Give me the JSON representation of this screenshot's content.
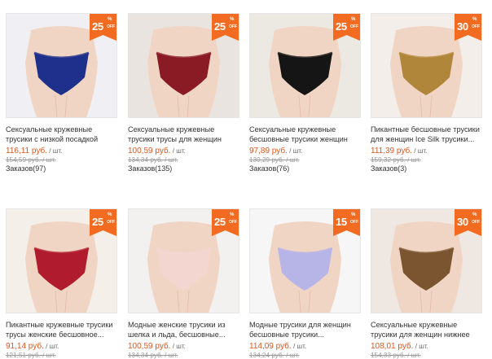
{
  "products": [
    {
      "title": "Сексуальные кружевные трусики с низкой посадкой трусики...",
      "price": "116,11 руб.",
      "unit": " / шт.",
      "old_price": "154,59 руб.",
      "orders": "Заказов(97)",
      "discount": "25",
      "product_color": "#1f2f8c",
      "bg": "#f0f0f4"
    },
    {
      "title": "Сексуальные кружевные трусики трусы для женщин бесшовное...",
      "price": "100,59 руб.",
      "unit": " / шт.",
      "old_price": "134,34 руб.",
      "orders": "Заказов(135)",
      "discount": "25",
      "product_color": "#8a1a24",
      "bg": "#e9e4e0"
    },
    {
      "title": "Сексуальные кружевные бесшовные трусики женщин нижнее белье...",
      "price": "97,89 руб.",
      "unit": " / шт.",
      "old_price": "130,29 руб.",
      "orders": "Заказов(76)",
      "discount": "25",
      "product_color": "#151515",
      "bg": "#ece9e3"
    },
    {
      "title": "Пикантные бесшовные трусики для женщин Ice Silk трусики...",
      "price": "111,39 руб.",
      "unit": " / шт.",
      "old_price": "159,32 руб.",
      "orders": "Заказов(3)",
      "discount": "30",
      "product_color": "#b0873a",
      "bg": "#f3eeea"
    },
    {
      "title": "Пикантные кружевные трусики трусы женские бесшовное...",
      "price": "91,14 руб.",
      "unit": " / шт.",
      "old_price": "121,51 руб.",
      "orders": "",
      "discount": "25",
      "product_color": "#b01c2e",
      "bg": "#f4efe9"
    },
    {
      "title": "Модные женские трусики из шелка и льда, бесшовные...",
      "price": "100,59 руб.",
      "unit": " / шт.",
      "old_price": "134,34 руб.",
      "orders": "",
      "discount": "25",
      "product_color": "#f2d6cf",
      "bg": "#f3f1ef"
    },
    {
      "title": "Модные трусики для женщин бесшовные трусики...",
      "price": "114,09 руб.",
      "unit": " / шт.",
      "old_price": "134,24 руб.",
      "orders": "",
      "discount": "15",
      "product_color": "#b7b4e8",
      "bg": "#f6f6f6"
    },
    {
      "title": "Сексуальные кружевные трусики для женщин нижнее белье...",
      "price": "108,01 руб.",
      "unit": " / шт.",
      "old_price": "154,33 руб.",
      "orders": "",
      "discount": "30",
      "product_color": "#7a5530",
      "bg": "#efe8e2"
    }
  ],
  "badge": {
    "percent": "%",
    "off": "OFF",
    "color": "#f26b21"
  }
}
